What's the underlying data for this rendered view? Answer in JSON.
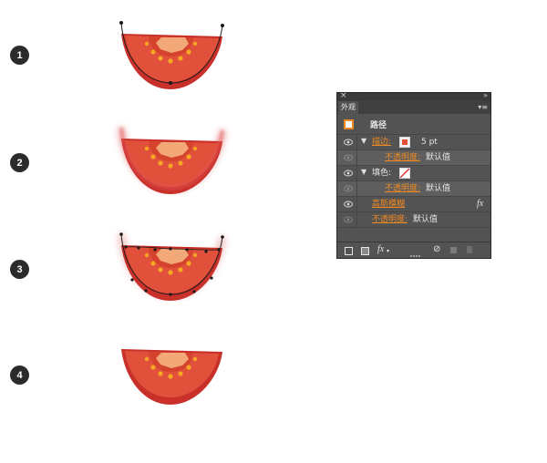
{
  "steps": [
    "1",
    "2",
    "3",
    "4"
  ],
  "panel": {
    "tab": "外观",
    "object_title": "路径",
    "stroke": {
      "label": "描边:",
      "width": "5 pt",
      "color": "#e0503a"
    },
    "stroke_opacity": {
      "label": "不透明度:",
      "value": "默认值"
    },
    "fill": {
      "label": "填色:"
    },
    "fill_opacity": {
      "label": "不透明度:",
      "value": "默认值"
    },
    "effect": {
      "label": "高斯模糊",
      "fx": "fx"
    },
    "object_opacity": {
      "label": "不透明度:",
      "value": "默认值"
    },
    "bottom_fx": "fx"
  },
  "colors": {
    "tomato_skin": "#c9302a",
    "tomato_flesh": "#e0503a",
    "tomato_core": "#f2a977",
    "seed": "#f5a623",
    "accent_orange": "#f08a24",
    "panel_bg": "#535353"
  }
}
